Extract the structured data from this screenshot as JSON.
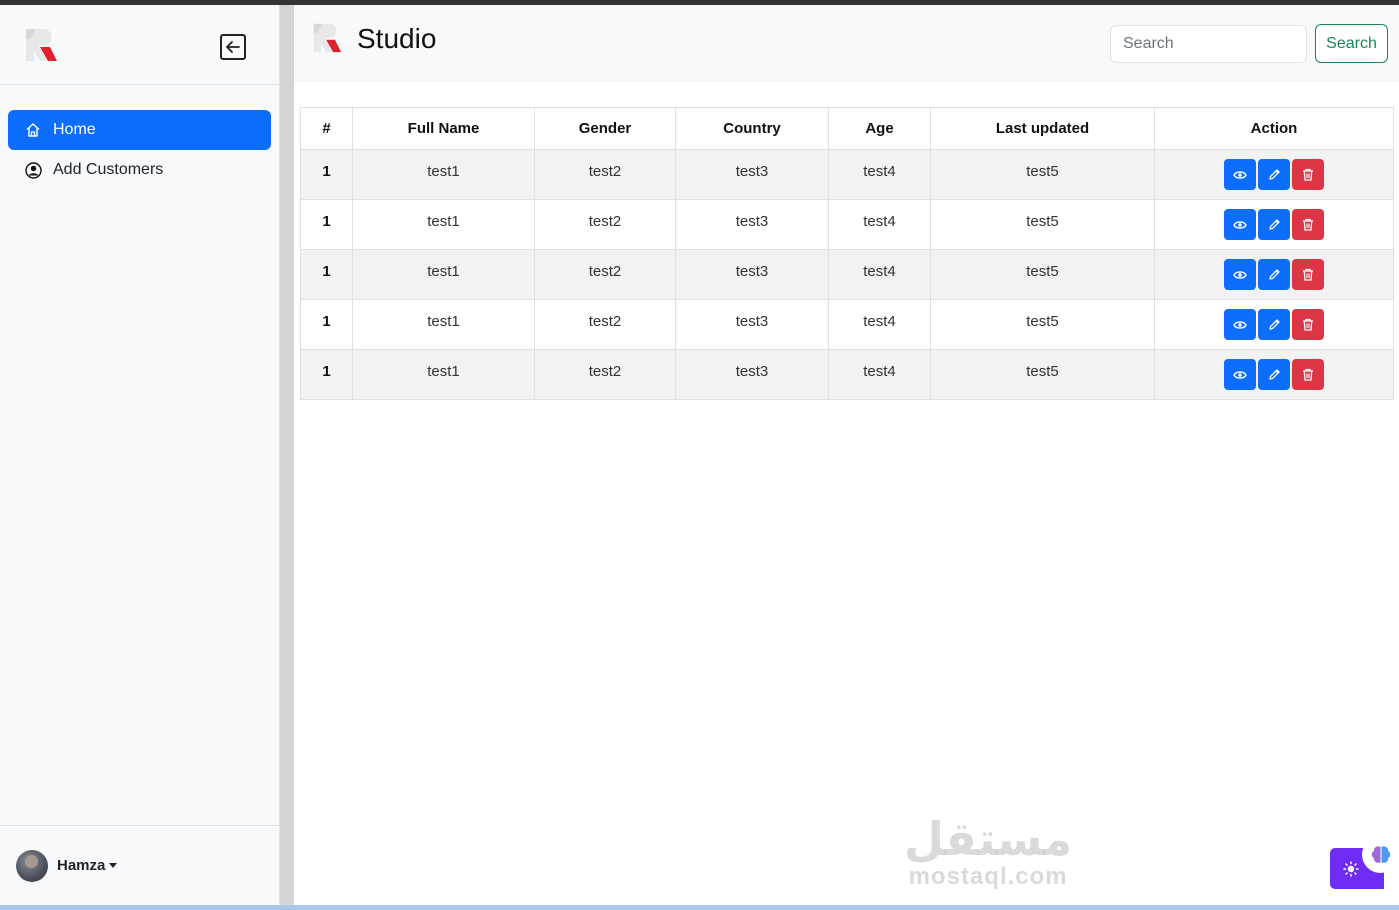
{
  "sidebar": {
    "items": [
      {
        "label": "Home",
        "icon": "home-icon",
        "active": true
      },
      {
        "label": "Add Customers",
        "icon": "user-circle-icon",
        "active": false
      }
    ],
    "user": {
      "name": "Hamza"
    }
  },
  "header": {
    "title": "Studio",
    "search": {
      "placeholder": "Search",
      "value": ""
    },
    "search_button": "Search"
  },
  "table": {
    "columns": [
      "#",
      "Full Name",
      "Gender",
      "Country",
      "Age",
      "Last updated",
      "Action"
    ],
    "rows": [
      {
        "num": "1",
        "full_name": "test1",
        "gender": "test2",
        "country": "test3",
        "age": "test4",
        "last_updated": "test5"
      },
      {
        "num": "1",
        "full_name": "test1",
        "gender": "test2",
        "country": "test3",
        "age": "test4",
        "last_updated": "test5"
      },
      {
        "num": "1",
        "full_name": "test1",
        "gender": "test2",
        "country": "test3",
        "age": "test4",
        "last_updated": "test5"
      },
      {
        "num": "1",
        "full_name": "test1",
        "gender": "test2",
        "country": "test3",
        "age": "test4",
        "last_updated": "test5"
      },
      {
        "num": "1",
        "full_name": "test1",
        "gender": "test2",
        "country": "test3",
        "age": "test4",
        "last_updated": "test5"
      }
    ],
    "actions": [
      "eye-icon",
      "pencil-icon",
      "trash-icon"
    ]
  },
  "watermark": {
    "arabic": "مستقل",
    "latin": "mostaql.com"
  },
  "colors": {
    "primary": "#0d6efd",
    "danger": "#dc3545",
    "success": "#198754",
    "accent": "#6f2cf6"
  }
}
